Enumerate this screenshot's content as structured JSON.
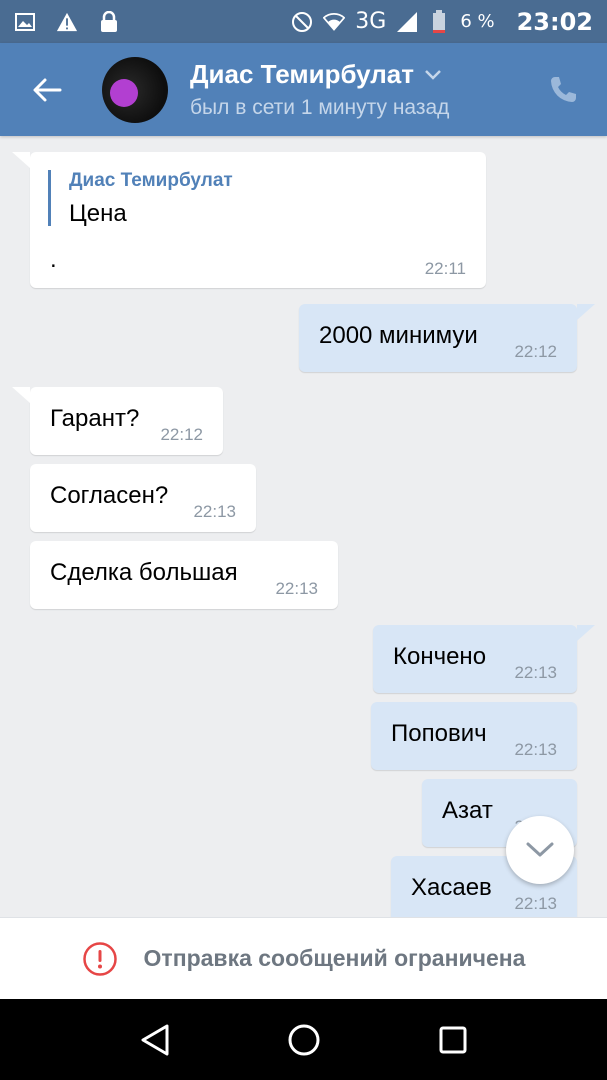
{
  "status_bar": {
    "network": "3G",
    "battery": "6 %",
    "time": "23:02",
    "icons": [
      "gallery-icon",
      "warning-icon",
      "lock-icon",
      "dnd-icon",
      "wifi-icon",
      "signal-icon",
      "battery-icon"
    ]
  },
  "header": {
    "title": "Диас Темирбулат",
    "subtitle": "был в сети 1 минуту назад",
    "accent_color": "#5181b8"
  },
  "messages": [
    {
      "dir": "in",
      "quote_author": "Диас Темирбулат",
      "quote_text": "Цена",
      "text": ".",
      "time": "22:11"
    },
    {
      "dir": "out",
      "text": "2000 минимуи",
      "time": "22:12"
    },
    {
      "dir": "in",
      "text": "Гарант?",
      "time": "22:12"
    },
    {
      "dir": "in",
      "text": "Согласен?",
      "time": "22:13"
    },
    {
      "dir": "in",
      "text": "Сделка большая",
      "time": "22:13"
    },
    {
      "dir": "out",
      "text": "Кончено",
      "time": "22:13"
    },
    {
      "dir": "out",
      "text": "Попович",
      "time": "22:13"
    },
    {
      "dir": "out",
      "text": "Азат",
      "time": "22:13"
    },
    {
      "dir": "out",
      "text": "Хасаев",
      "time": "22:13"
    }
  ],
  "footer": {
    "restriction_text": "Отправка сообщений ограничена",
    "restriction_icon_color": "#e64646"
  }
}
